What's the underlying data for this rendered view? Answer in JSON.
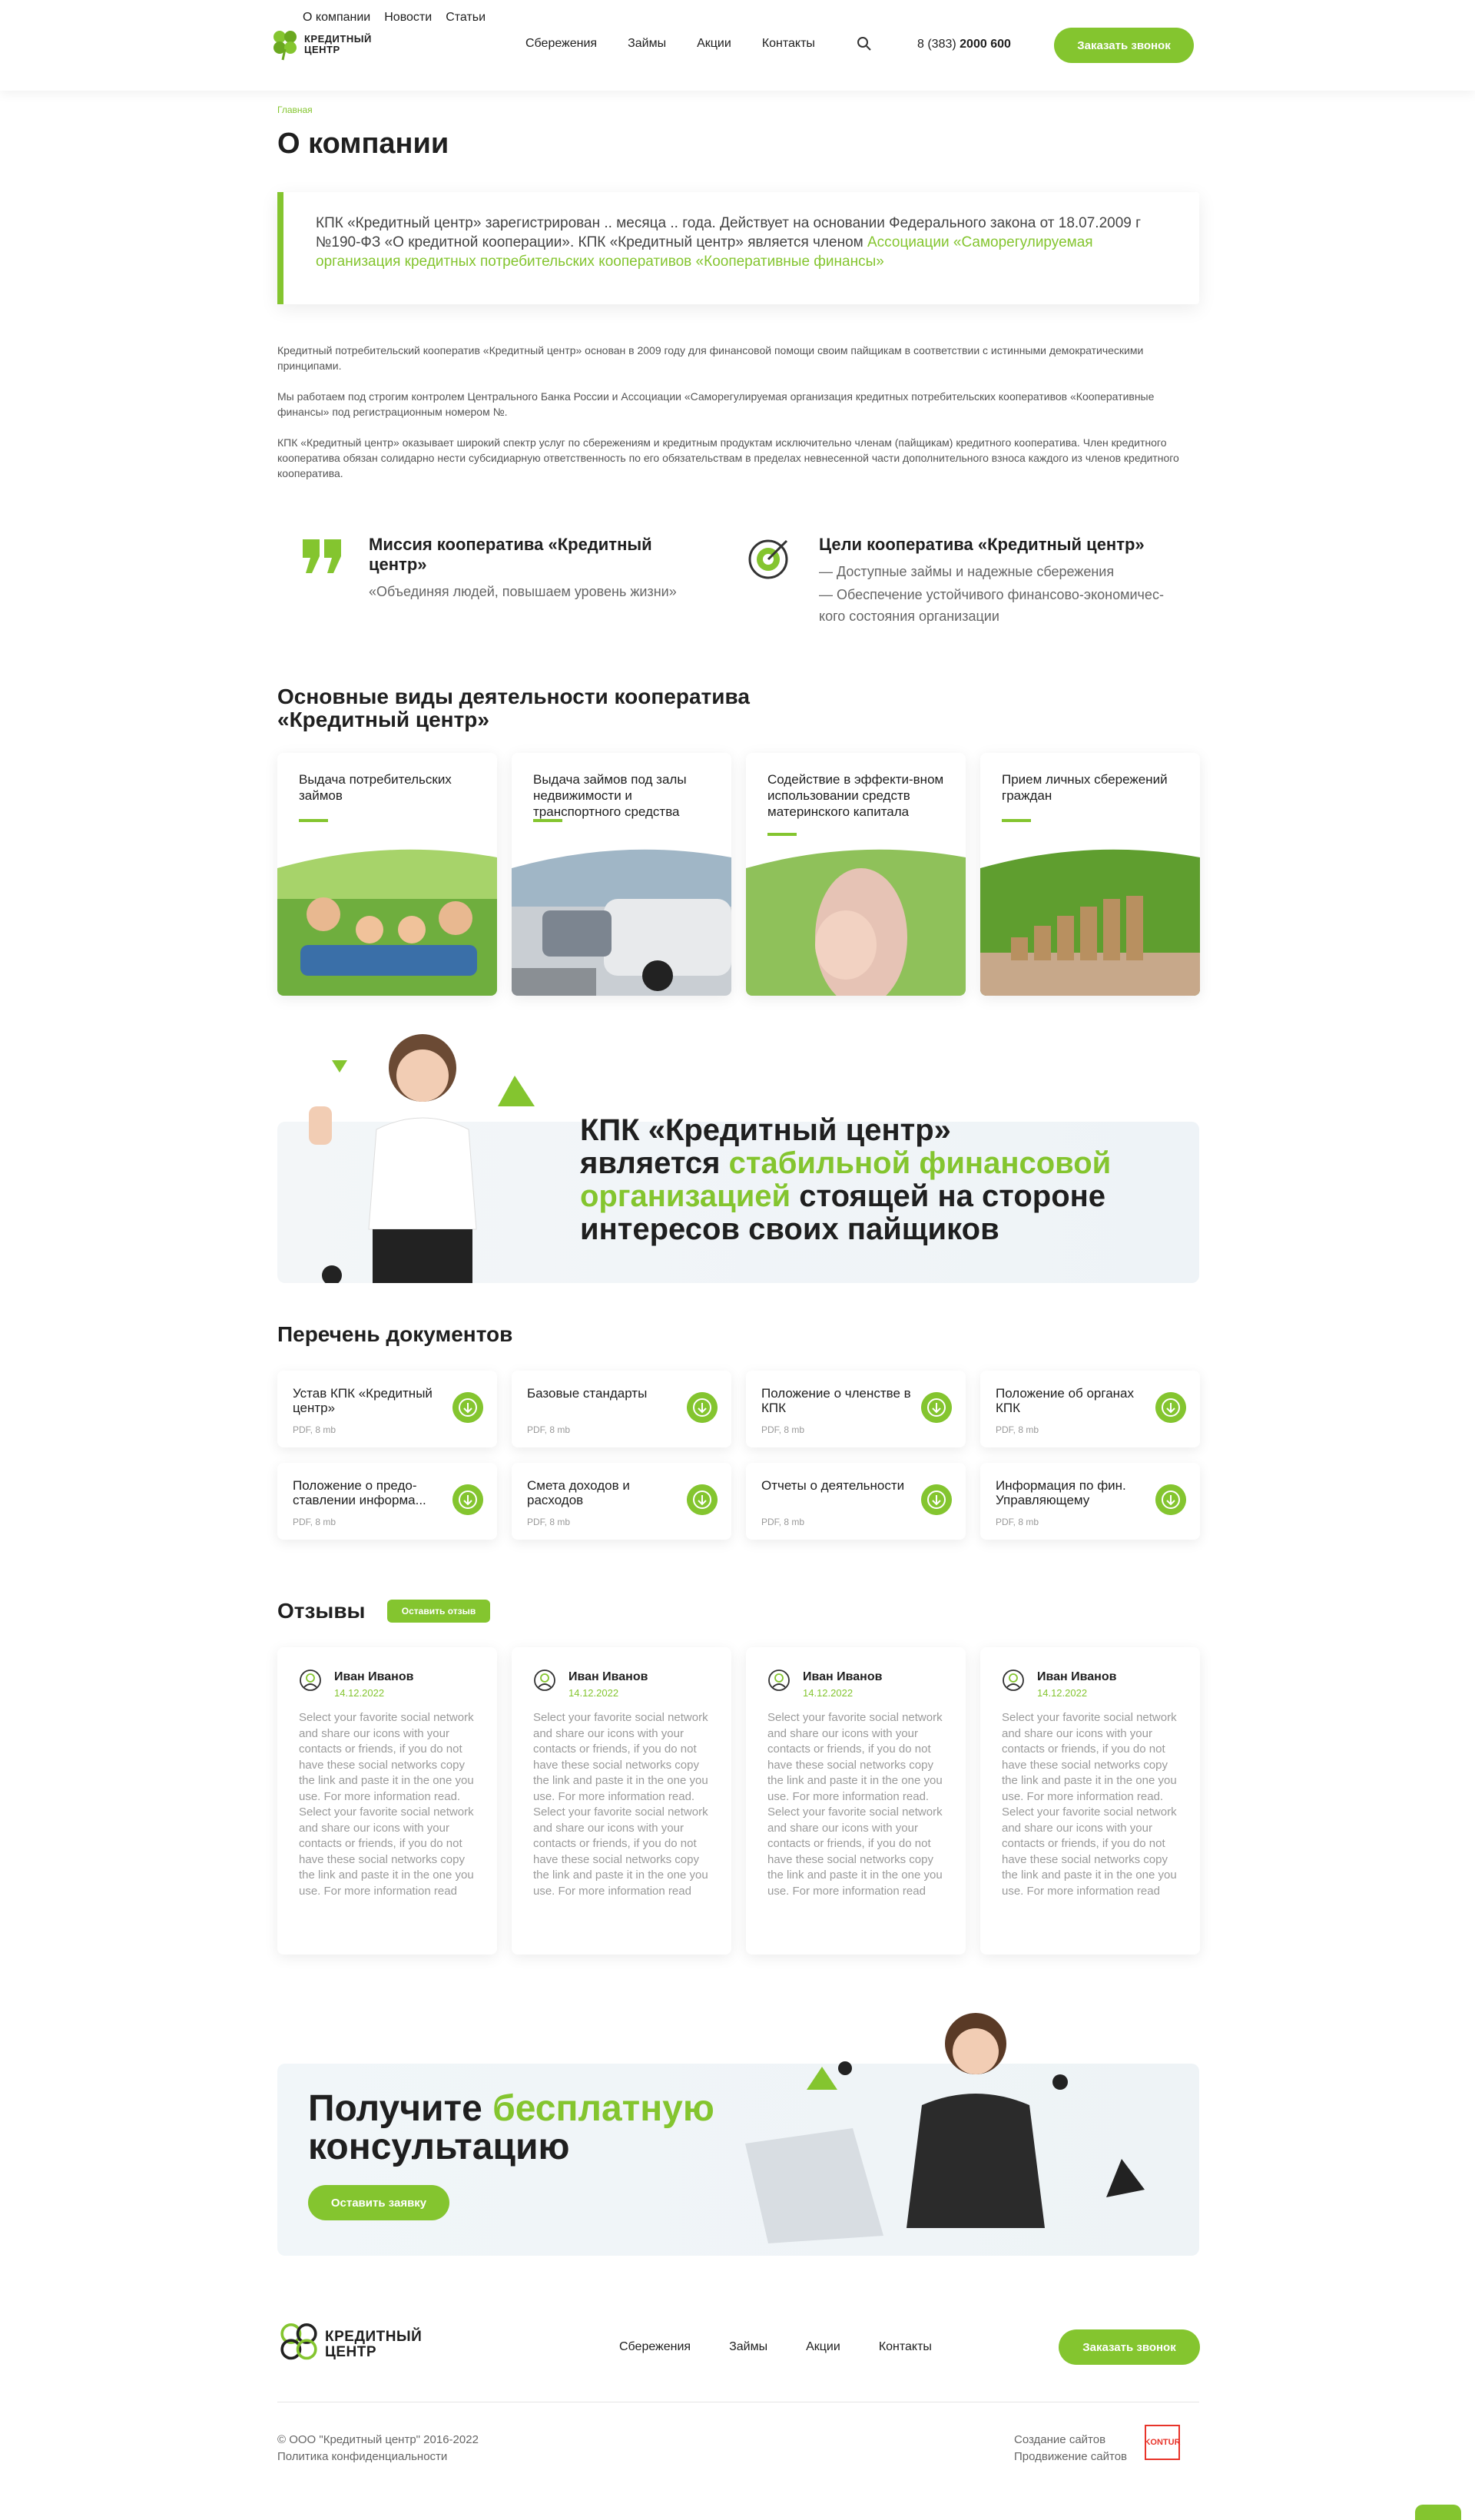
{
  "header": {
    "topnav": [
      "О компании",
      "Новости",
      "Статьи"
    ],
    "logo_line1": "КРЕДИТНЫЙ",
    "logo_line2": "ЦЕНТР",
    "mainnav": [
      "Сбережения",
      "Займы",
      "Акции",
      "Контакты"
    ],
    "phone_prefix": "8 (383)",
    "phone_number": "2000 600",
    "cta": "Заказать звонок"
  },
  "breadcrumb": "Главная",
  "page_title": "О компании",
  "intro": {
    "text": "КПК «Кредитный центр» зарегистрирован .. месяца .. года. Действует на основании Федерального закона от 18.07.2009 г №190-ФЗ «О кредитной кооперации». КПК «Кредитный центр» является членом ",
    "link": "Ассоциации «Саморегулируемая организация кредитных потребительских кооперативов «Кооперативные финансы»"
  },
  "paragraphs": [
    "Кредитный потребительский кооператив «Кредитный центр» основан в 2009 году для финансовой помощи своим пайщикам в соответствии с истинными демократическими принципами.",
    "Мы работаем под строгим контролем Центрального Банка России и Ассоциации «Саморегулируемая организация кредитных потребительских кооперативов «Кооперативные финансы» под регистрационным номером №.",
    "КПК «Кредитный центр» оказывает широкий спектр услуг по сбережениям и кредитным продуктам исключительно членам (пайщикам) кредитного кооператива. Член кредитного кооператива обязан солидарно нести субсидиарную ответственность по его обязательствам в пределах невнесенной части дополнительного взноса каждого из членов кредитного кооператива."
  ],
  "mission": {
    "title": "Миссия кооператива «Кредитный центр»",
    "text": "«Объединяя людей, повышаем уровень жизни»"
  },
  "goals": {
    "title": "Цели кооператива «Кредитный центр»",
    "items": [
      "— Доступные займы и надежные сбережения",
      "— Обеспечение устойчивого финансово-экономичес-кого состояния организации"
    ]
  },
  "activities": {
    "title": "Основные виды деятельности кооператива «Кредитный центр»",
    "cards": [
      "Выдача потребительских займов",
      "Выдача займов под залы недвижимости и транспортного средства",
      "Содействие в эффекти-вном использовании средств материнского капитала",
      "Прием личных сбережений граждан"
    ]
  },
  "banner": {
    "line1": "КПК «Кредитный центр»",
    "pre": "является ",
    "highlight": "стабильной финансовой организацией",
    "post": " стоящей на стороне интересов своих пайщиков"
  },
  "documents": {
    "title": "Перечень документов",
    "items": [
      {
        "name": "Устав КПК «Кредитный центр»",
        "meta": "PDF, 8 mb"
      },
      {
        "name": "Базовые стандарты",
        "meta": "PDF, 8 mb"
      },
      {
        "name": "Положение о членстве в КПК",
        "meta": "PDF, 8 mb"
      },
      {
        "name": "Положение об органах КПК",
        "meta": "PDF, 8 mb"
      },
      {
        "name": "Положение о предо-ставлении информа...",
        "meta": "PDF, 8 mb"
      },
      {
        "name": "Смета доходов и расходов",
        "meta": "PDF, 8 mb"
      },
      {
        "name": "Отчеты о деятельности",
        "meta": "PDF, 8 mb"
      },
      {
        "name": "Информация по фин. Управляющему",
        "meta": "PDF, 8 mb"
      }
    ]
  },
  "reviews": {
    "title": "Отзывы",
    "button": "Оставить отзыв",
    "items": [
      {
        "name": "Иван Иванов",
        "date": "14.12.2022",
        "text": "Select your favorite social network and share our icons with your contacts or friends, if you do not have these social networks copy the link and paste it in the one you use. For more information read. Select your favorite social network and share our icons with your contacts or friends, if you do not have these social networks copy the link and paste it in the one you use. For more information read"
      },
      {
        "name": "Иван Иванов",
        "date": "14.12.2022",
        "text": "Select your favorite social network and share our icons with your contacts or friends, if you do not have these social networks copy the link and paste it in the one you use. For more information read. Select your favorite social network and share our icons with your contacts or friends, if you do not have these social networks copy the link and paste it in the one you use. For more information read"
      },
      {
        "name": "Иван Иванов",
        "date": "14.12.2022",
        "text": "Select your favorite social network and share our icons with your contacts or friends, if you do not have these social networks copy the link and paste it in the one you use. For more information read. Select your favorite social network and share our icons with your contacts or friends, if you do not have these social networks copy the link and paste it in the one you use. For more information read"
      },
      {
        "name": "Иван Иванов",
        "date": "14.12.2022",
        "text": "Select your favorite social network and share our icons with your contacts or friends, if you do not have these social networks copy the link and paste it in the one you use. For more information read. Select your favorite social network and share our icons with your contacts or friends, if you do not have these social networks copy the link and paste it in the one you use. For more information read"
      }
    ]
  },
  "cta": {
    "pre": "Получите ",
    "highlight": "бесплатную",
    "line2": "консультацию",
    "button": "Оставить заявку"
  },
  "footer": {
    "logo_line1": "КРЕДИТНЫЙ",
    "logo_line2": "ЦЕНТР",
    "nav": [
      "Сбережения",
      "Займы",
      "Акции",
      "Контакты"
    ],
    "cta": "Заказать звонок",
    "copyright": "© ООО \"Кредитный центр\" 2016-2022",
    "privacy": "Политика конфиденциальности",
    "made1": "Создание сайтов",
    "made2": "Продвижение сайтов",
    "kontur": "KONTUR"
  },
  "colors": {
    "accent": "#84c52f",
    "text": "#1f1f1f"
  }
}
